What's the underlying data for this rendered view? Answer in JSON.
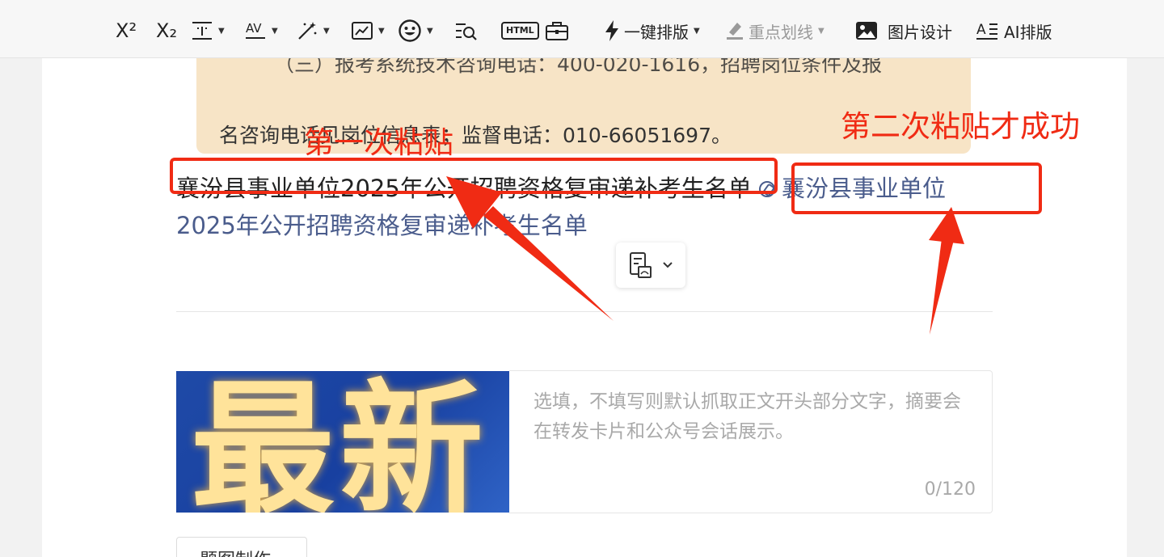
{
  "toolbar": {
    "superscript_label": "X²",
    "subscript_label": "X₂",
    "one_click_layout": "一键排版",
    "highlight_line": "重点划线",
    "image_design": "图片设计",
    "ai_layout": "AI排版",
    "html_label": "HTML"
  },
  "quote": {
    "line1": "（三）报考系统技术咨询电话：400-020-1616，招聘岗位条件及报",
    "line2": "名咨询电话见岗位信息表；监督电话：010-66051697。"
  },
  "annotations": {
    "first_paste": "第一次粘贴",
    "second_paste": "第二次粘贴才成功"
  },
  "content": {
    "plain_title": "襄汾县事业单位2025年公开招聘资格复审递补考生名单",
    "link_title_part1": "襄汾县事业单位",
    "link_title_part2": "2025年公开招聘资格复审递补考生名单"
  },
  "cover": {
    "image_text": "最新",
    "button_label": "题图制作"
  },
  "summary": {
    "placeholder": "选填，不填写则默认抓取正文开头部分文字，摘要会在转发卡片和公众号会话展示。",
    "counter": "0/120"
  },
  "colors": {
    "annotation_red": "#f02b14",
    "link_blue": "#4a5c8c",
    "quote_bg": "#f7e4c6"
  },
  "icons": [
    "superscript-icon",
    "subscript-icon",
    "line-spacing-icon",
    "letter-spacing-icon",
    "magic-wand-icon",
    "image-icon",
    "emoji-icon",
    "find-replace-icon",
    "html-icon",
    "briefcase-icon",
    "lightning-icon",
    "highlighter-icon",
    "picture-icon",
    "ai-layout-icon",
    "link-icon",
    "paste-options-icon"
  ]
}
